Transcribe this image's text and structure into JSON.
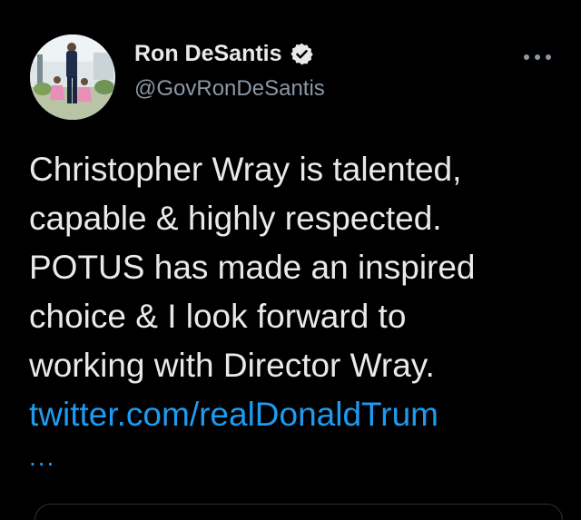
{
  "author": {
    "name": "Ron DeSantis",
    "handle": "@GovRonDeSantis",
    "verified": true,
    "avatar_icon": "profile-photo"
  },
  "more_icon": "more-options-icon",
  "tweet": {
    "lines": [
      "Christopher Wray is talented,",
      "capable & highly respected.",
      "POTUS has made an inspired",
      "choice & I look forward to",
      "working with Director Wray."
    ],
    "link_text": "twitter.com/realDonaldTrum",
    "ellipsis": "..."
  },
  "colors": {
    "background": "#000000",
    "text": "#e7e9ea",
    "secondary": "#8b98a5",
    "link": "#1d9bf0"
  }
}
